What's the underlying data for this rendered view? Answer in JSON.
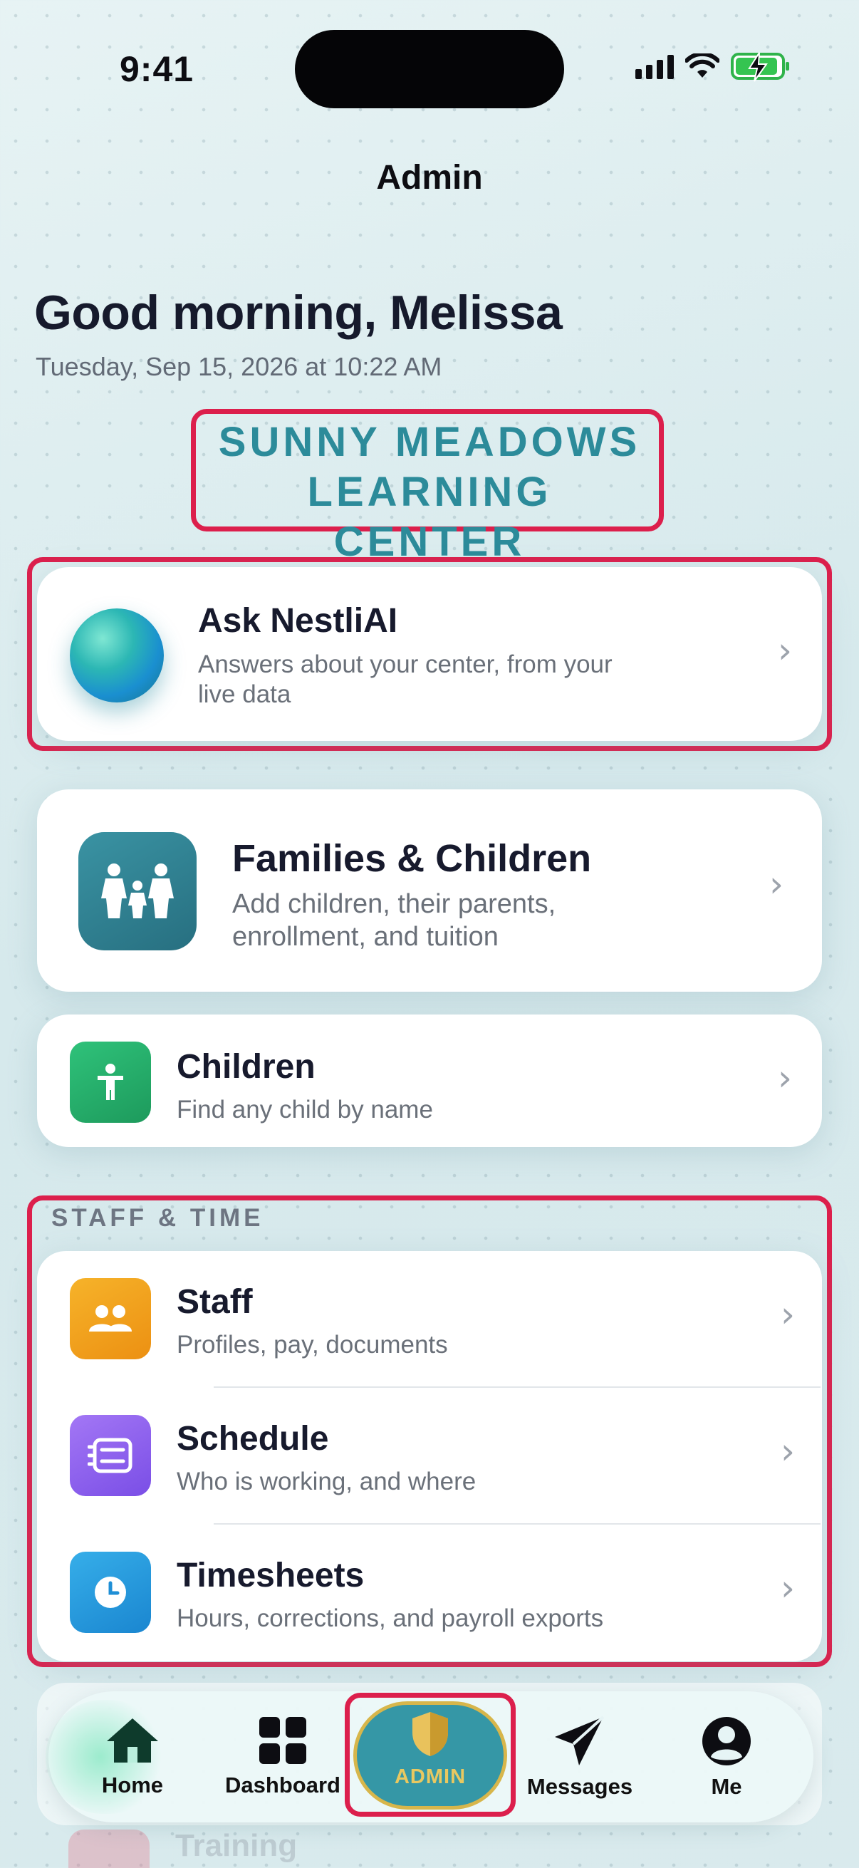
{
  "status_bar": {
    "time": "9:41"
  },
  "nav": {
    "title": "Admin"
  },
  "greeting": "Good morning, Melissa",
  "date_line": "Tuesday, Sep 15, 2026 at 10:22 AM",
  "center": {
    "line1": "SUNNY MEADOWS",
    "line2": "LEARNING CENTER"
  },
  "ask_ai": {
    "title": "Ask NestliAI",
    "subtitle_line1": "Answers about your center, from your",
    "subtitle_line2": "live data"
  },
  "families": {
    "title": "Families & Children",
    "subtitle_line1": "Add children, their parents,",
    "subtitle_line2": "enrollment, and tuition"
  },
  "children": {
    "title": "Children",
    "subtitle": "Find any child by name"
  },
  "staff_section": {
    "label": "STAFF & TIME",
    "rows": [
      {
        "title": "Staff",
        "subtitle": "Profiles, pay, documents"
      },
      {
        "title": "Schedule",
        "subtitle": "Who is working, and where"
      },
      {
        "title": "Timesheets",
        "subtitle": "Hours, corrections, and payroll exports"
      }
    ]
  },
  "behind_tabbar": {
    "partial_title": "Training"
  },
  "tabs": [
    {
      "label": "Home"
    },
    {
      "label": "Dashboard"
    },
    {
      "label": "ADMIN"
    },
    {
      "label": "Messages"
    },
    {
      "label": "Me"
    }
  ],
  "colors": {
    "highlight": "#dc1f4c",
    "accent_teal": "#2c8b9a",
    "staff_icon": "#f0a11a",
    "schedule_icon": "#8b5cf0",
    "timesheets_icon": "#2196d9",
    "children_icon": "#23b06a",
    "families_icon": "#2e7f8f",
    "admin_gold": "#d7b64b"
  }
}
